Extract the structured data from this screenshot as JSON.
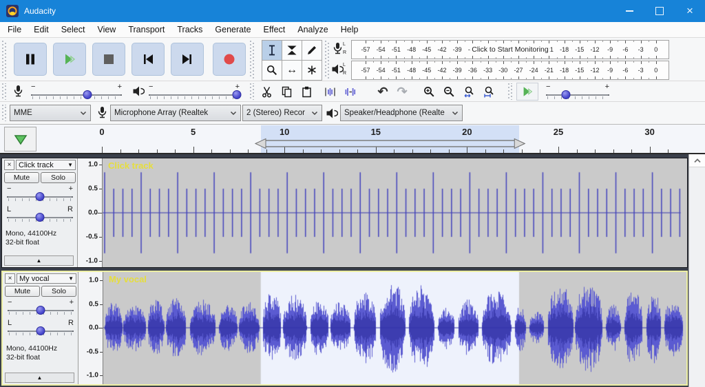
{
  "window": {
    "title": "Audacity"
  },
  "menu": {
    "items": [
      "File",
      "Edit",
      "Select",
      "View",
      "Transport",
      "Tracks",
      "Generate",
      "Effect",
      "Analyze",
      "Help"
    ]
  },
  "transport": {
    "buttons": [
      "pause",
      "play",
      "stop",
      "skip-to-start",
      "skip-to-end",
      "record"
    ]
  },
  "tools": {
    "items": [
      "selection",
      "envelope",
      "draw",
      "zoom",
      "time-shift",
      "multi-tool"
    ],
    "selected": "selection"
  },
  "meters": {
    "scale": [
      "-57",
      "-54",
      "-51",
      "-48",
      "-45",
      "-42",
      "-39",
      "-36",
      "-33",
      "-30",
      "-27",
      "-24",
      "-21",
      "-18",
      "-15",
      "-12",
      "-9",
      "-6",
      "-3",
      "0"
    ],
    "channels": [
      "L",
      "R"
    ],
    "recording_overlay": "Click to Start Monitoring"
  },
  "mixer": {
    "recording_volume": 0.62,
    "playback_volume": 0.97
  },
  "slider_labels": {
    "minus": "−",
    "plus": "+",
    "left": "L",
    "right": "R"
  },
  "edit_toolbar": {
    "buttons": [
      "cut",
      "copy",
      "paste",
      "trim-outside-selection",
      "silence-selection",
      "undo",
      "redo",
      "zoom-in",
      "zoom-out",
      "fit-selection",
      "fit-project"
    ]
  },
  "play_at_speed": {
    "value": 0.31
  },
  "device": {
    "host": "MME",
    "input": "Microphone Array (Realtek",
    "input_channels": "2 (Stereo) Recor",
    "output": "Speaker/Headphone (Realte"
  },
  "timeline": {
    "tick_labels": [
      "0",
      "5",
      "10",
      "15",
      "20",
      "25",
      "30"
    ],
    "tick_seconds": [
      0,
      5,
      10,
      15,
      20,
      25,
      30
    ],
    "selection_start_s": 8.7,
    "selection_end_s": 22.85
  },
  "tracks": [
    {
      "name": "Click track",
      "mute": "Mute",
      "solo": "Solo",
      "format_line1": "Mono, 44100Hz",
      "format_line2": "32-bit float",
      "amp_labels": [
        "1.0",
        "0.5",
        "0.0",
        "-0.5",
        "-1.0"
      ],
      "amp_values": [
        1,
        0.5,
        0,
        -0.5,
        -1
      ],
      "gain": 0.5,
      "pan": 0.5,
      "selected": false,
      "waveform": {
        "type": "click",
        "interval_s": 0.5,
        "accent_every": 4,
        "accent_amp": 0.84,
        "normal_amp": 0.5,
        "start_s": 0.15,
        "end_s": 31.7
      }
    },
    {
      "name": "My vocal",
      "mute": "Mute",
      "solo": "Solo",
      "format_line1": "Mono, 44100Hz",
      "format_line2": "32-bit float",
      "amp_labels": [
        "1.0",
        "0.5",
        "0.0",
        "-0.5",
        "-1.0"
      ],
      "amp_values": [
        1,
        0.5,
        0,
        -0.5,
        -1
      ],
      "gain": 0.5,
      "pan": 0.5,
      "selected": true,
      "waveform": {
        "type": "vocal",
        "seed": 7,
        "bursts": [
          [
            0.15,
            1.1,
            0.55
          ],
          [
            1.15,
            2.4,
            0.5
          ],
          [
            2.5,
            3.4,
            0.6
          ],
          [
            3.5,
            4.6,
            0.65
          ],
          [
            4.8,
            6.2,
            0.6
          ],
          [
            6.4,
            7.4,
            0.5
          ],
          [
            7.5,
            8.6,
            0.55
          ],
          [
            8.8,
            9.8,
            0.75
          ],
          [
            9.9,
            11.2,
            0.7
          ],
          [
            11.4,
            12.4,
            0.6
          ],
          [
            12.5,
            13.6,
            0.55
          ],
          [
            13.8,
            15.0,
            0.8
          ],
          [
            15.2,
            16.6,
            0.95
          ],
          [
            16.8,
            18.2,
            0.9
          ],
          [
            18.4,
            19.3,
            0.45
          ],
          [
            19.5,
            20.6,
            0.6
          ],
          [
            20.8,
            22.4,
            0.8
          ],
          [
            22.6,
            23.2,
            0.5
          ],
          [
            23.4,
            24.2,
            0.35
          ],
          [
            24.4,
            25.8,
            0.9
          ],
          [
            25.9,
            27.4,
            0.95
          ],
          [
            27.6,
            28.4,
            0.5
          ],
          [
            28.6,
            29.6,
            0.8
          ],
          [
            29.8,
            30.6,
            0.75
          ],
          [
            30.8,
            31.8,
            0.65
          ]
        ]
      }
    }
  ],
  "colors": {
    "titlebar": "#1783d8",
    "button_face": "#ccd9ed",
    "wave_outer": "#5b5bd1",
    "wave_inner": "#3d3db0",
    "wave_bg": "#cacaca",
    "wave_bg_selected": "#eef2fc",
    "zero_line": "#3232aa",
    "click_spike": "#4343bd",
    "track_name": "#e6de3c",
    "ruler_selection": "#d3e0f6",
    "selected_track_border": "#edefa3"
  }
}
